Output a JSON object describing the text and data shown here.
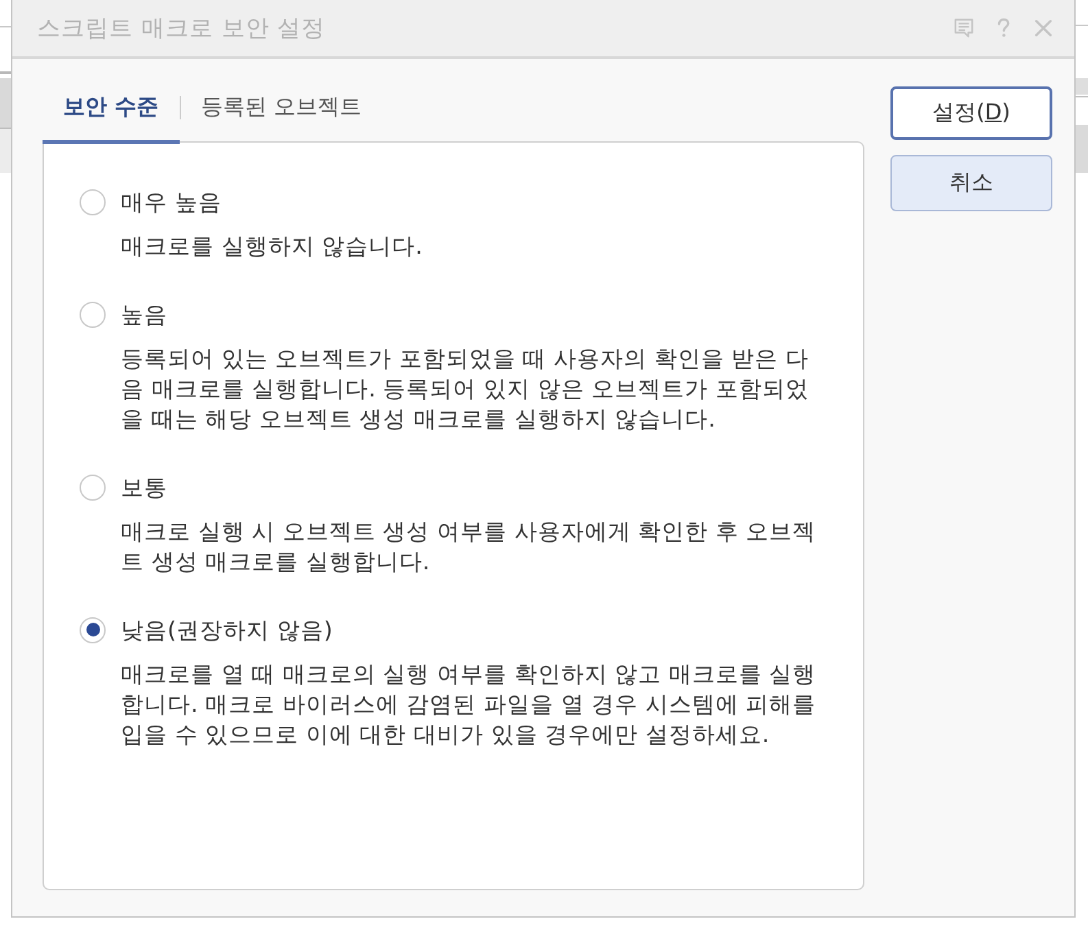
{
  "window": {
    "title": "스크립트 매크로 보안 설정"
  },
  "tabs": [
    {
      "label": "보안 수준",
      "selected": true
    },
    {
      "label": "등록된 오브젝트",
      "selected": false
    }
  ],
  "security_levels": [
    {
      "label": "매우 높음",
      "description": "매크로를 실행하지 않습니다.",
      "selected": false
    },
    {
      "label": "높음",
      "description": "등록되어 있는 오브젝트가 포함되었을 때 사용자의 확인을 받은 다음 매크로를 실행합니다. 등록되어 있지 않은 오브젝트가 포함되었을 때는 해당 오브젝트 생성 매크로를 실행하지 않습니다.",
      "selected": false
    },
    {
      "label": "보통",
      "description": "매크로 실행 시 오브젝트 생성 여부를 사용자에게 확인한 후 오브젝트 생성 매크로를 실행합니다.",
      "selected": false
    },
    {
      "label": "낮음(권장하지 않음)",
      "description": "매크로를 열 때 매크로의 실행 여부를 확인하지 않고 매크로를 실행합니다. 매크로 바이러스에 감염된 파일을 열 경우 시스템에 피해를 입을 수 있으므로 이에 대한 대비가 있을 경우에만 설정하세요.",
      "selected": true
    }
  ],
  "buttons": [
    {
      "kind": "default",
      "label": "설정(",
      "access_key": "D",
      "label_end": ")"
    },
    {
      "kind": "normal",
      "label": "취소"
    }
  ]
}
